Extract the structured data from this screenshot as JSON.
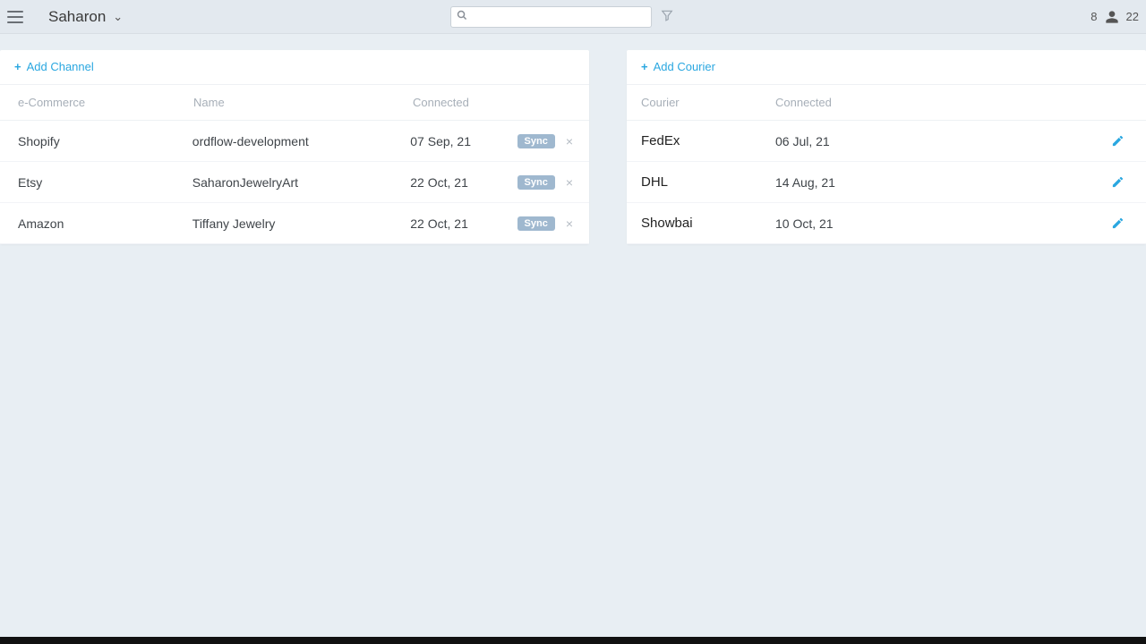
{
  "header": {
    "workspace": "Saharon",
    "notif_count": "8",
    "right_number": "22"
  },
  "channels": {
    "add_label": "Add Channel",
    "cols": {
      "ecom": "e-Commerce",
      "name": "Name",
      "connected": "Connected"
    },
    "sync_label": "Sync",
    "rows": [
      {
        "ecom": "Shopify",
        "name": "ordflow-development",
        "connected": "07 Sep, 21"
      },
      {
        "ecom": "Etsy",
        "name": "SaharonJewelryArt",
        "connected": "22 Oct, 21"
      },
      {
        "ecom": "Amazon",
        "name": "Tiffany Jewelry",
        "connected": "22 Oct, 21"
      }
    ]
  },
  "couriers": {
    "add_label": "Add Courier",
    "cols": {
      "courier": "Courier",
      "connected": "Connected"
    },
    "rows": [
      {
        "courier": "FedEx",
        "connected": "06 Jul, 21"
      },
      {
        "courier": "DHL",
        "connected": "14 Aug, 21"
      },
      {
        "courier": "Showbai",
        "connected": "10 Oct, 21"
      }
    ]
  }
}
